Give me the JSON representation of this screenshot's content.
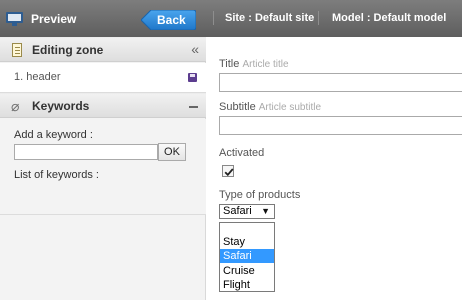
{
  "topbar": {
    "preview_label": "Preview",
    "back_label": "Back",
    "site": "Site : Default site",
    "model": "Model : Default model",
    "colors": {
      "bar": "#6b6b6b",
      "back_button": "#2f8ee0"
    }
  },
  "left_panel": {
    "editing_zone": {
      "title": "Editing zone",
      "icon": "document-icon",
      "collapse_icon": "double-chevron-left-icon",
      "items": [
        {
          "label": "1. header",
          "icon": "save-icon"
        }
      ]
    },
    "keywords": {
      "title": "Keywords",
      "icon": "tag-icon",
      "collapse_icon": "minus-icon",
      "add_label": "Add a keyword :",
      "input_value": "",
      "ok_label": "OK",
      "list_label": "List of keywords :"
    }
  },
  "form": {
    "title": {
      "label": "Title",
      "hint": "Article title",
      "value": ""
    },
    "subtitle": {
      "label": "Subtitle",
      "hint": "Article subtitle",
      "value": ""
    },
    "activated": {
      "label": "Activated",
      "checked": true
    },
    "type": {
      "label": "Type of products",
      "selected": "Safari",
      "options": [
        {
          "label": "",
          "selected": false
        },
        {
          "label": "Stay",
          "selected": false
        },
        {
          "label": "Safari",
          "selected": true
        },
        {
          "label": "Cruise",
          "selected": false
        },
        {
          "label": "Flight",
          "selected": false
        }
      ],
      "colors": {
        "highlight": "#3399ff"
      }
    }
  }
}
